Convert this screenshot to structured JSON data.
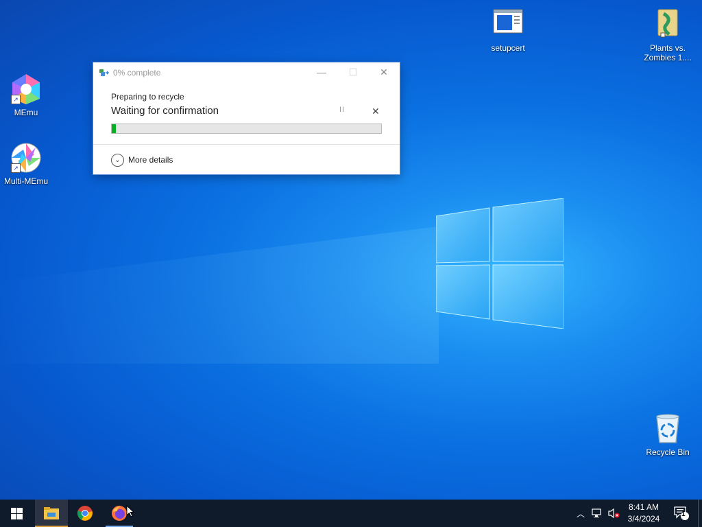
{
  "desktop": {
    "icons": [
      {
        "label": "setupcert",
        "icon": "setupcert-window-icon"
      },
      {
        "label": "Plants vs. Zombies 1....",
        "icon": "plants-vs-zombies-folder-icon"
      },
      {
        "label": "MEmu",
        "icon": "memu-icon"
      },
      {
        "label": "Multi-MEmu",
        "icon": "multi-memu-icon"
      },
      {
        "label": "Recycle Bin",
        "icon": "recycle-bin-icon"
      }
    ]
  },
  "dialog": {
    "title": "0% complete",
    "subtitle": "Preparing to recycle",
    "status": "Waiting for confirmation",
    "pause_glyph": "II",
    "cancel_glyph": "✕",
    "progress": 0.015,
    "more_details_label": "More details",
    "progress_color": "#06b025"
  },
  "taskbar": {
    "apps": [
      "start-icon",
      "file-explorer-icon",
      "chrome-icon",
      "firefox-icon"
    ],
    "tray": {
      "time": "8:41 AM",
      "date": "3/4/2024",
      "notification_count": "1"
    }
  }
}
